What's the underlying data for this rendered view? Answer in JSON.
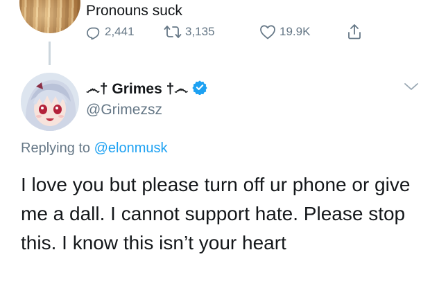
{
  "parent_tweet": {
    "text": "Pronouns suck",
    "reply_count": "2,441",
    "retweet_count": "3,135",
    "like_count": "19.9K"
  },
  "tweet": {
    "display_name": "෴† Grimes †෴",
    "handle": "@Grimezsz",
    "replying_prefix": "Replying to",
    "replying_to": "@elonmusk",
    "body": "I love you but please turn off ur phone or give me a dall.  I cannot support hate.  Please stop this. I know this isn’t your heart"
  },
  "colors": {
    "link": "#1da1f2",
    "muted": "#657786",
    "verified": "#1da1f2"
  },
  "icons": [
    "reply-icon",
    "retweet-icon",
    "like-icon",
    "share-icon",
    "verified-icon",
    "chevron-down-icon"
  ]
}
